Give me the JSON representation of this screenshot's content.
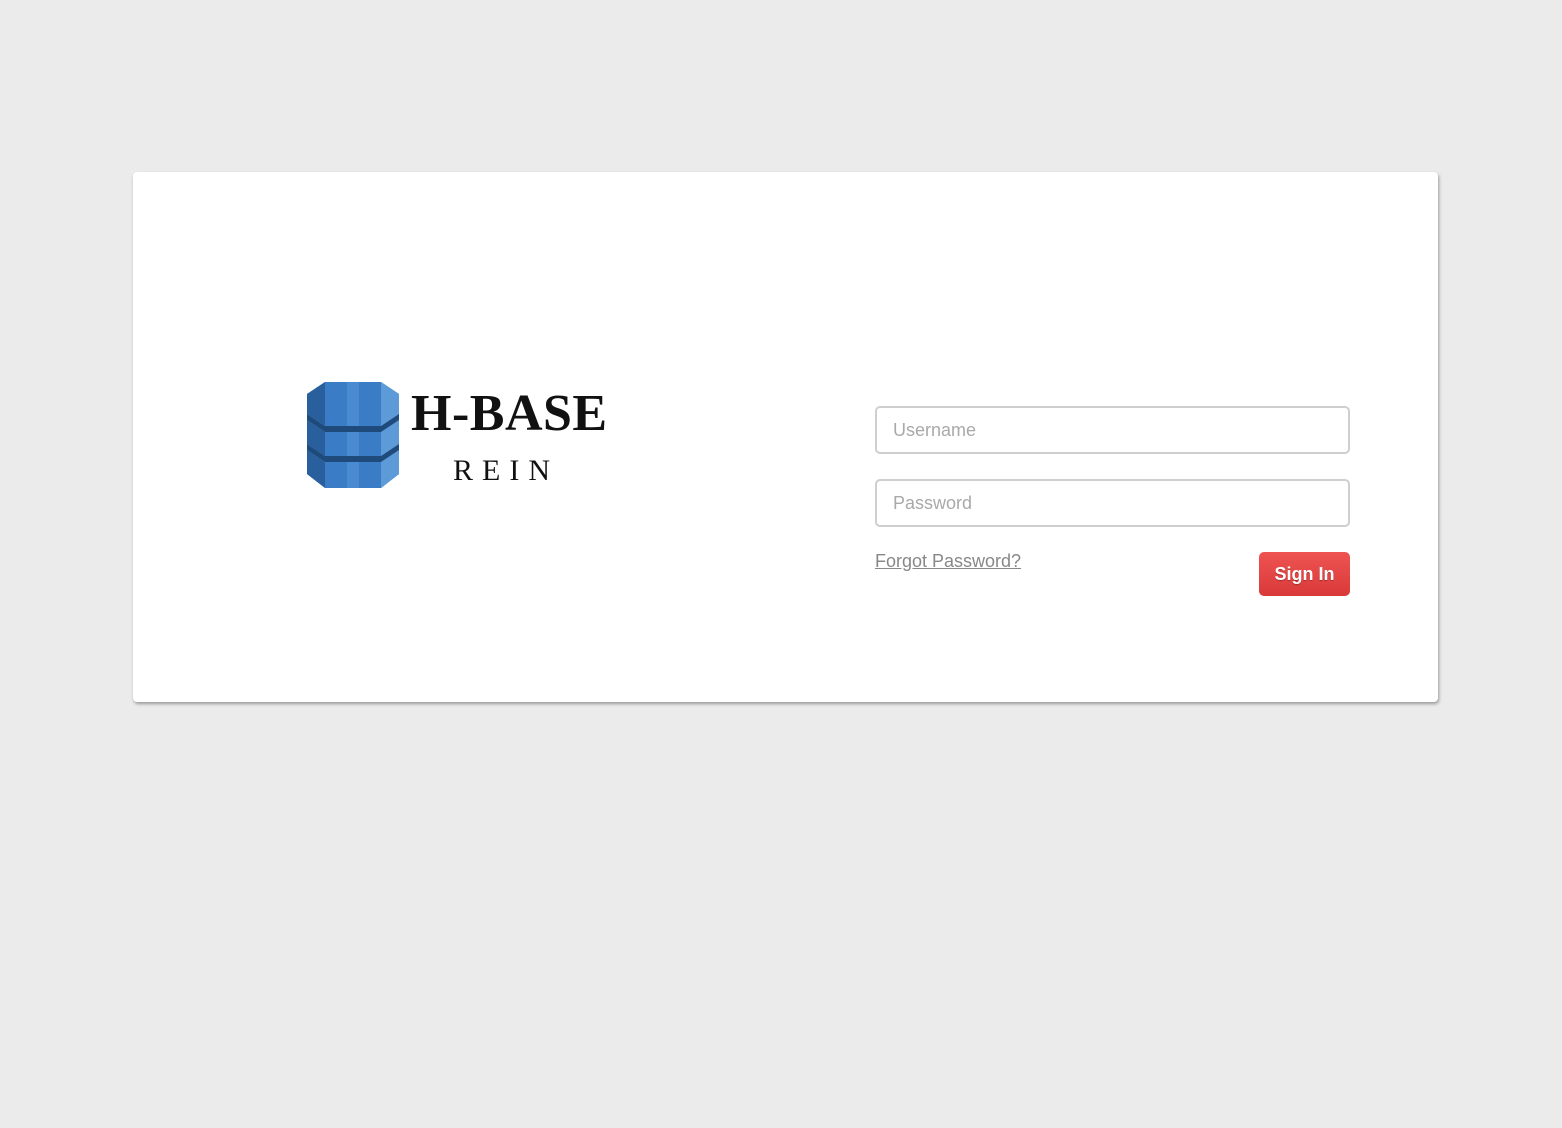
{
  "brand": {
    "title": "H-BASE",
    "subtitle": "REIN",
    "icon": "hbase-database-icon"
  },
  "login": {
    "username_placeholder": "Username",
    "username_value": "",
    "password_placeholder": "Password",
    "password_value": "",
    "forgot_label": "Forgot Password?",
    "signin_label": "Sign In"
  },
  "colors": {
    "background": "#ebebeb",
    "card": "#ffffff",
    "logo_blue": "#3a7cc6",
    "signin_button": "#e44746",
    "link": "#888888"
  }
}
